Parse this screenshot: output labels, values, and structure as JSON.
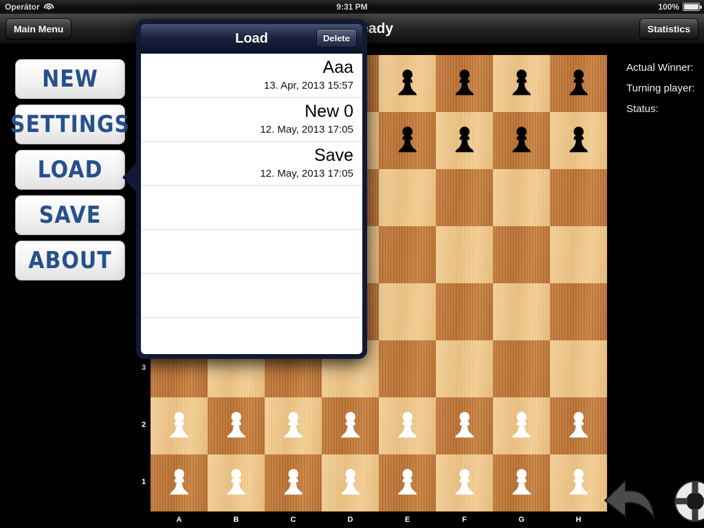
{
  "status_bar": {
    "carrier": "Operátor",
    "wifi_icon": "wifi-icon",
    "time": "9:31 PM",
    "battery_percent": "100%",
    "battery_icon": "battery-full-icon"
  },
  "nav_bar": {
    "main_menu_label": "Main Menu",
    "title": "Game ready",
    "statistics_label": "Statistics"
  },
  "side_menu": {
    "items": [
      {
        "label": "NEW",
        "name": "new"
      },
      {
        "label": "SETTINGS",
        "name": "settings"
      },
      {
        "label": "LOAD",
        "name": "load"
      },
      {
        "label": "SAVE",
        "name": "save"
      },
      {
        "label": "ABOUT",
        "name": "about"
      }
    ]
  },
  "popover": {
    "title": "Load",
    "delete_label": "Delete",
    "anchor": "load",
    "saves": [
      {
        "name": "Aaa",
        "date": "13. Apr, 2013 15:57"
      },
      {
        "name": "New 0",
        "date": "12. May, 2013 17:05"
      },
      {
        "name": "Save",
        "date": "12. May, 2013 17:05"
      }
    ],
    "empty_rows": 4
  },
  "board": {
    "files": [
      "A",
      "B",
      "C",
      "D",
      "E",
      "F",
      "G",
      "H"
    ],
    "ranks_visible": [
      "3",
      "2",
      "1"
    ],
    "light_color": "#eec184",
    "dark_color": "#c07838",
    "position": [
      [
        "bp",
        "bp",
        "bp",
        "bp",
        "bp",
        "bp",
        "bp",
        "bp"
      ],
      [
        "bp",
        "bp",
        "bp",
        "bp",
        "bp",
        "bp",
        "bp",
        "bp"
      ],
      [
        "",
        "",
        "",
        "",
        "",
        "",
        "",
        ""
      ],
      [
        "",
        "",
        "",
        "",
        "",
        "",
        "",
        ""
      ],
      [
        "",
        "",
        "",
        "",
        "",
        "",
        "",
        ""
      ],
      [
        "",
        "",
        "",
        "",
        "",
        "",
        "",
        ""
      ],
      [
        "wp",
        "wp",
        "wp",
        "wp",
        "wp",
        "wp",
        "wp",
        "wp"
      ],
      [
        "wp",
        "wp",
        "wp",
        "wp",
        "wp",
        "wp",
        "wp",
        "wp"
      ]
    ]
  },
  "info_panel": {
    "rows": [
      {
        "label": "Actual Winner:",
        "value": ""
      },
      {
        "label": "Turning player:",
        "value": ""
      },
      {
        "label": "Status:",
        "value": ""
      }
    ]
  },
  "controls": {
    "undo_icon": "undo-arrow-icon",
    "help_icon": "life-ring-icon"
  }
}
